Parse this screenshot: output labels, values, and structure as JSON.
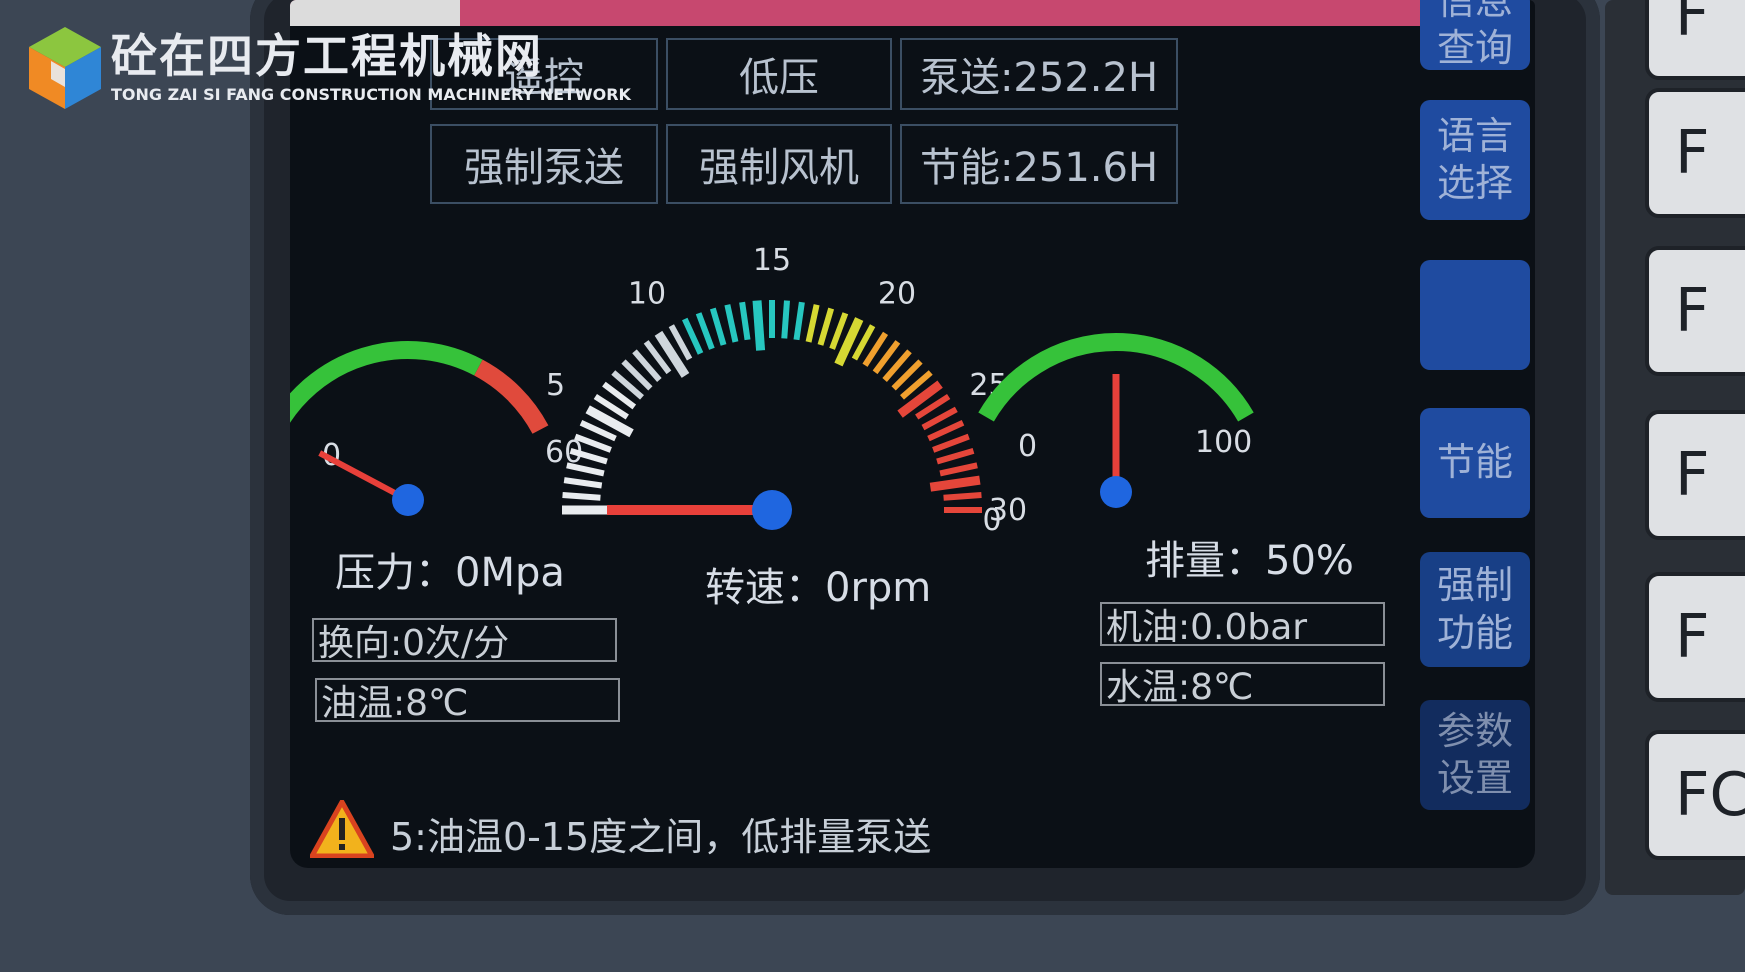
{
  "watermark": {
    "title_cn": "砼在四方工程机械网",
    "title_en": "TONG ZAI SI FANG CONSTRUCTION MACHINERY NETWORK"
  },
  "top_buttons": {
    "remote_control": "遥控",
    "low_pressure": "低压",
    "pump_hours": "泵送:252.2H",
    "force_pump": "强制泵送",
    "force_fan": "强制风机",
    "eco_hours": "节能:251.6H"
  },
  "side_menu": {
    "query": "信息\n查询",
    "language": "语言\n选择",
    "blank": "",
    "energy_saving": "节能",
    "force_function": "强制\n功能",
    "param_settings": "参数\n设置"
  },
  "gauges": {
    "pressure": {
      "min_label": "0",
      "max_label": "60",
      "value": 0,
      "readout": "压力：0Mpa",
      "colors": {
        "normal": "#36c23a",
        "danger": "#e04a3c"
      }
    },
    "speed": {
      "ticks": [
        "0",
        "5",
        "10",
        "15",
        "20",
        "25",
        "30"
      ],
      "value": 0,
      "readout": "转速：0rpm"
    },
    "displacement": {
      "min_label": "0",
      "max_label": "100",
      "value": 50,
      "readout": "排量：50%",
      "color": "#36c23a"
    }
  },
  "fields": {
    "reversing": "换向:0次/分",
    "oil_temp": "油温:8℃",
    "engine_oil": "机油:0.0bar",
    "water_temp": "水温:8℃"
  },
  "alarm": {
    "icon": "warning-triangle-icon",
    "message": "5:油温0-15度之间，低排量泵送"
  },
  "function_keys": [
    "F",
    "F",
    "F",
    "F",
    "F",
    "FC"
  ],
  "colors": {
    "needle": "#e8403a",
    "hub": "#1f66e0",
    "side_button": "#1f4ba0"
  }
}
